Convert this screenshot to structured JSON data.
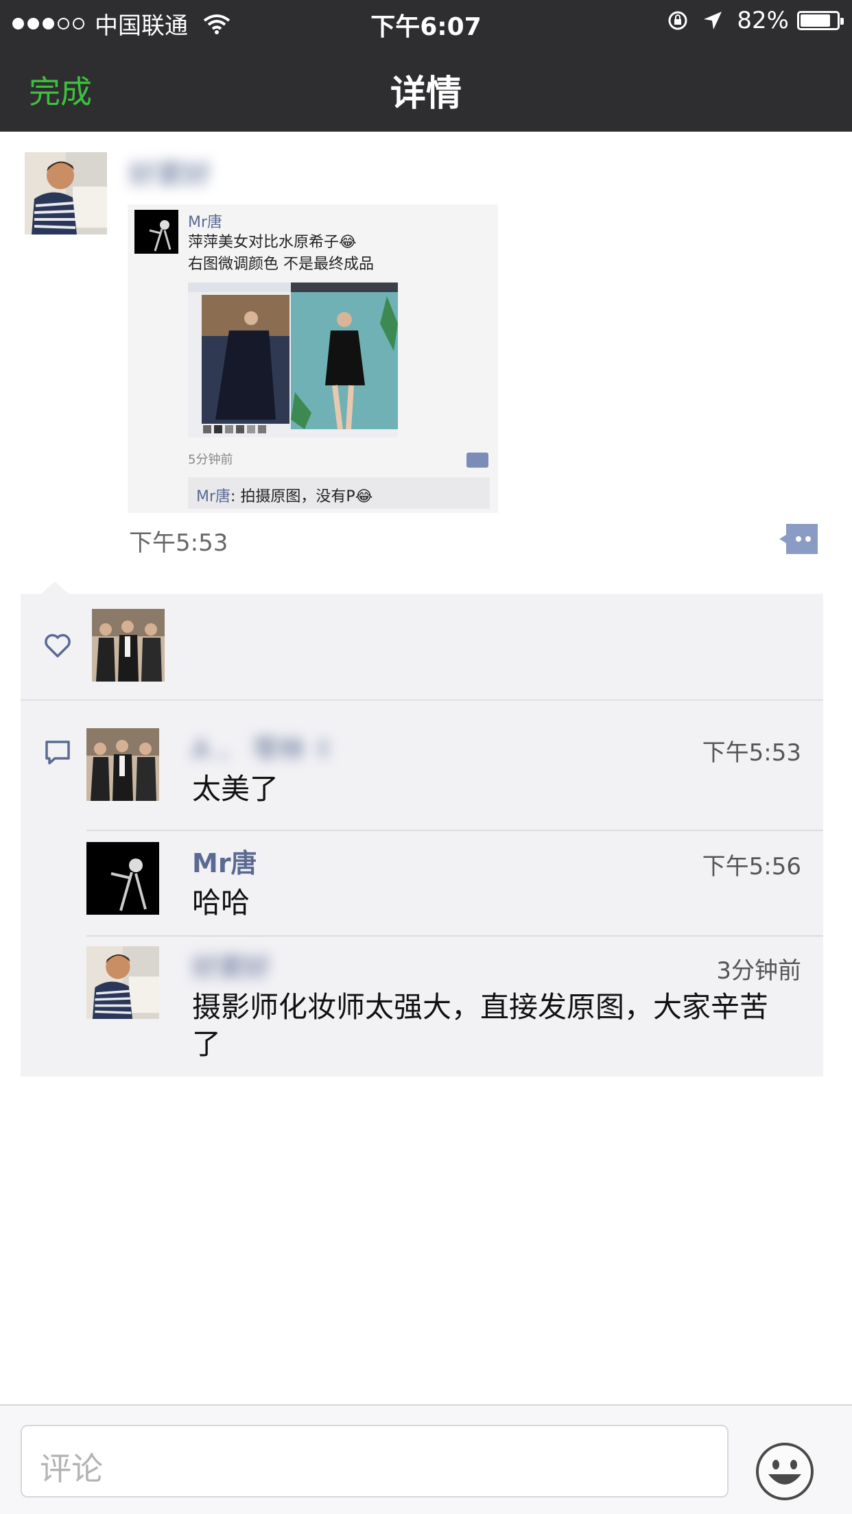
{
  "status_bar": {
    "carrier": "中国联通",
    "time": "下午6:07",
    "battery": "82%",
    "battery_level": 0.82,
    "signal_bars_filled": 3,
    "signal_bars_total": 5
  },
  "nav": {
    "done_label": "完成",
    "title": "详情"
  },
  "post": {
    "author": "好窦好",
    "time": "下午5:53",
    "screenshot": {
      "name": "Mr唐",
      "line1": "萍萍美女对比水原希子😂",
      "line2": "右图微调颜色 不是最终成品",
      "time": "5分钟前",
      "comment_name": "Mr唐",
      "comment_text": ": 拍摄原图，没有P😂"
    }
  },
  "comments": [
    {
      "name": "A 、 零林 ✌",
      "time": "下午5:53",
      "text": "太美了"
    },
    {
      "name": "Mr唐",
      "time": "下午5:56",
      "text": "哈哈"
    },
    {
      "name": "好窦好",
      "time": "3分钟前",
      "text": "摄影师化妆师太强大，直接发原图，大家辛苦了"
    }
  ],
  "input": {
    "placeholder": "评论"
  },
  "colors": {
    "accent_green": "#3dc13d",
    "name_blue": "#5a6a93",
    "topbar": "#2e2e31",
    "panel": "#f2f2f5"
  }
}
